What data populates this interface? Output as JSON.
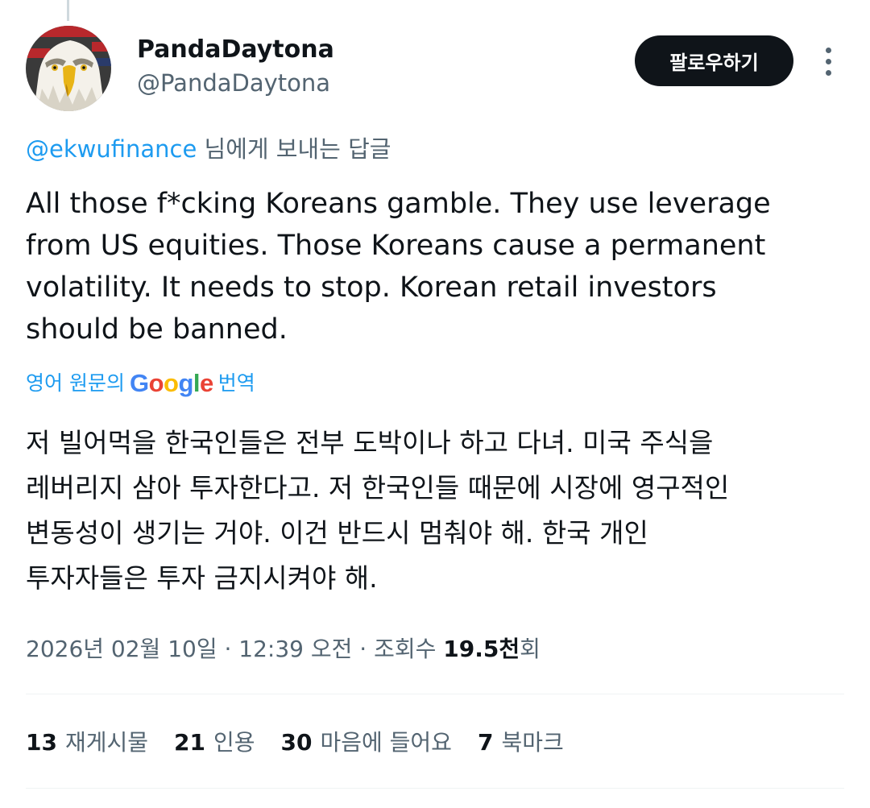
{
  "author": {
    "display_name": "PandaDaytona",
    "handle": "@PandaDaytona",
    "avatar_icon": "bald-eagle-avatar"
  },
  "follow_button_label": "팔로우하기",
  "more_icon": "more-vertical-icon",
  "reply_to": {
    "mention": "@ekwufinance",
    "suffix": " 님에게 보내는 답글"
  },
  "tweet": {
    "lines": [
      "All those f*cking Koreans gamble. They use leverage",
      "from US equities. Those Koreans cause a permanent",
      "volatility. It needs to stop. Korean retail investors",
      "should be banned."
    ]
  },
  "translation": {
    "prefix": "영어 원문의",
    "google_letters": [
      "G",
      "o",
      "o",
      "g",
      "l",
      "e"
    ],
    "suffix": "번역",
    "lines": [
      "저 빌어먹을 한국인들은 전부 도박이나 하고 다녀. 미국 주식을",
      "레버리지 삼아 투자한다고. 저 한국인들 때문에 시장에 영구적인",
      "변동성이 생기는 거야. 이건 반드시 멈춰야 해. 한국 개인",
      "투자자들은 투자 금지시켜야 해."
    ]
  },
  "meta": {
    "datetime": "2026년 02월 10일 · 12:39 오전 · 조회수 ",
    "views": "19.5천",
    "views_suffix": "회"
  },
  "stats": [
    {
      "count": "13",
      "label": "재게시물"
    },
    {
      "count": "21",
      "label": "인용"
    },
    {
      "count": "30",
      "label": "마음에 들어요"
    },
    {
      "count": "7",
      "label": "북마크"
    }
  ],
  "colors": {
    "accent": "#1d9bf0",
    "text": "#0f1419",
    "secondary": "#536471",
    "button_bg": "#0f1419"
  }
}
